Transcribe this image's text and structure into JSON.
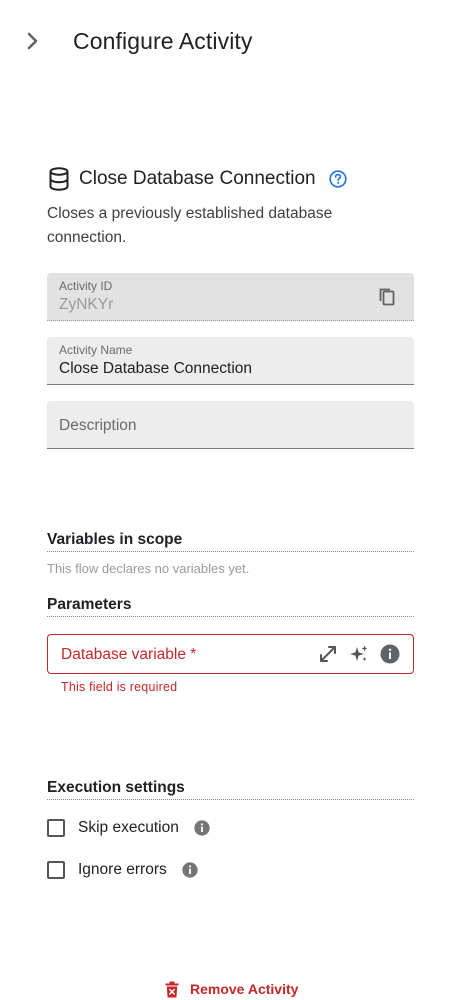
{
  "header": {
    "title": "Configure Activity",
    "collapse_icon": "chevron-right-icon"
  },
  "activity": {
    "icon": "database-icon",
    "title": "Close Database Connection",
    "help_icon": "help-circle-icon",
    "description": "Closes a previously established database connection."
  },
  "fields": {
    "activity_id": {
      "label": "Activity ID",
      "value": "ZyNKYr",
      "copy_icon": "copy-icon"
    },
    "activity_name": {
      "label": "Activity Name",
      "value": "Close Database Connection"
    },
    "description": {
      "placeholder": "Description"
    }
  },
  "variables": {
    "title": "Variables in scope",
    "note": "This flow declares no variables yet."
  },
  "parameters": {
    "title": "Parameters",
    "database_variable": {
      "label": "Database variable *",
      "error": "This field is required"
    }
  },
  "execution": {
    "title": "Execution settings",
    "skip_label": "Skip execution",
    "skip_checked": false,
    "ignore_label": "Ignore errors",
    "ignore_checked": false
  },
  "footer": {
    "remove_label": "Remove Activity"
  },
  "colors": {
    "error": "#c62828",
    "help": "#1e73d8",
    "text": "#202124",
    "field_bg": "#ededed"
  }
}
